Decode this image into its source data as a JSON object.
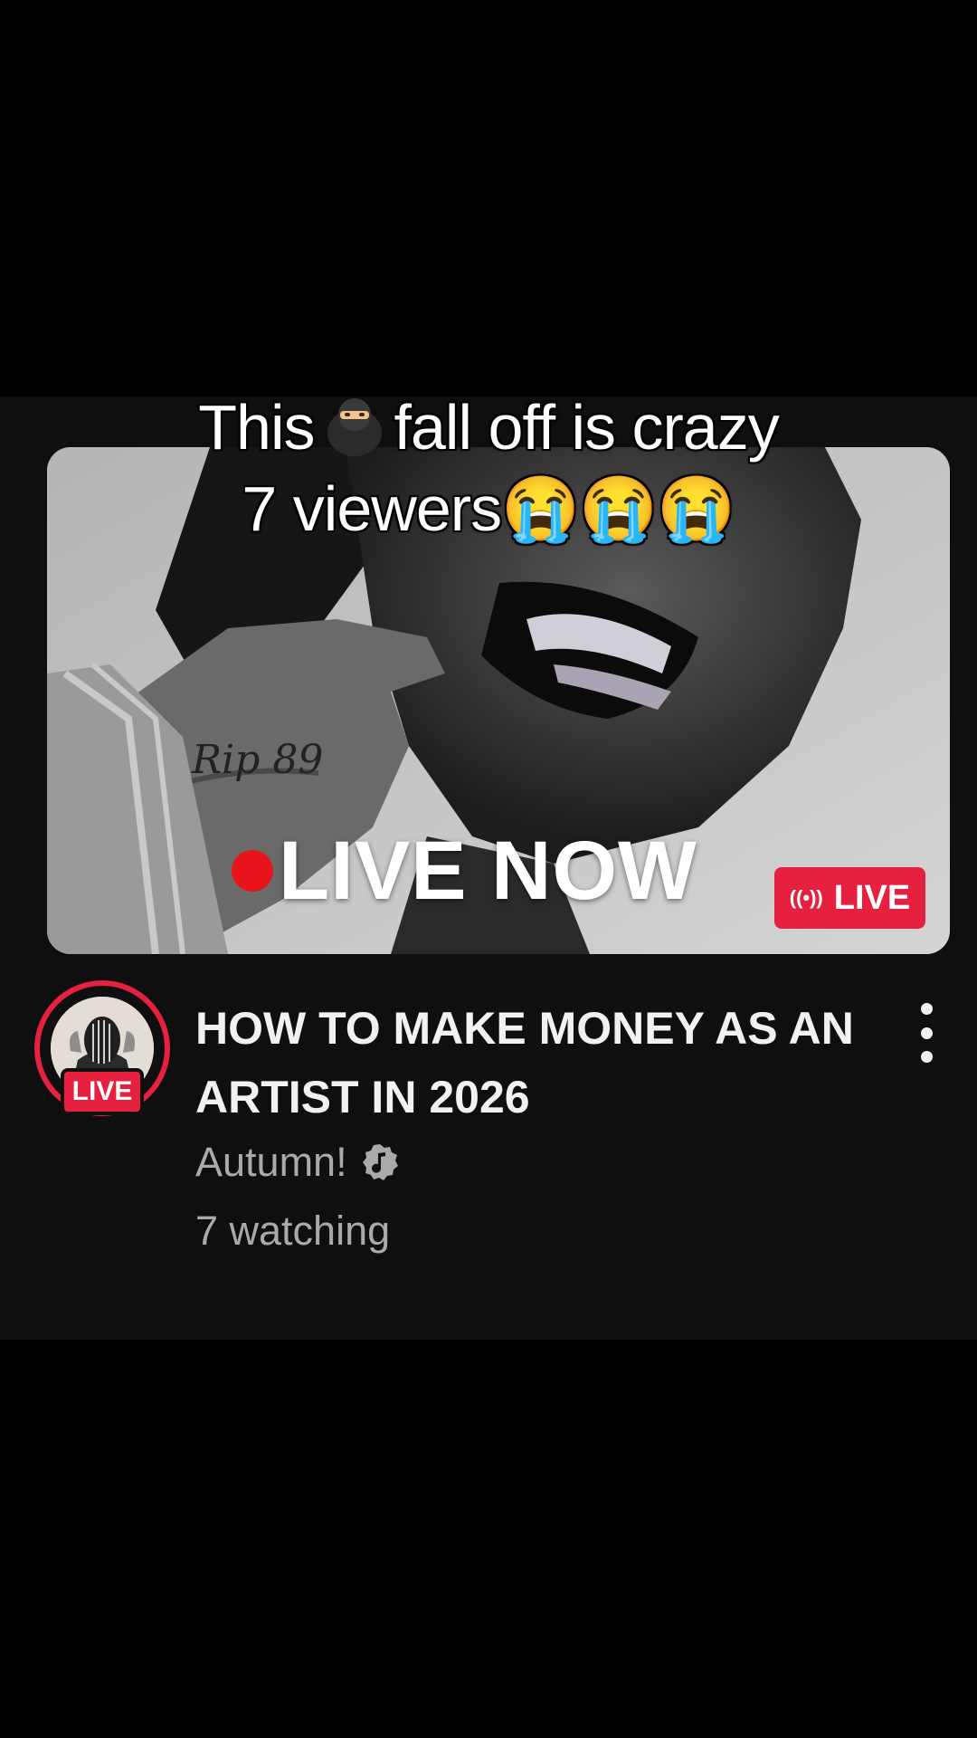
{
  "overlay_caption": {
    "line1_before": "This",
    "line1_emoji": "ninja-emoji",
    "line1_after": "fall off is crazy",
    "line2": "7 viewers😭😭😭"
  },
  "thumbnail": {
    "overlay_text": "LIVE NOW",
    "hand_tattoo": "Rip 89",
    "badge_label": "LIVE",
    "badge_icon": "broadcast-icon"
  },
  "video": {
    "title": "HOW TO MAKE MONEY AS AN ARTIST IN 2026",
    "channel": "Autumn!",
    "channel_badge_icon": "music-note-verified-icon",
    "viewers": "7 watching",
    "avatar_live_label": "LIVE",
    "more_icon": "more-vertical-icon"
  },
  "colors": {
    "background": "#000000",
    "card_background": "#0f0f0f",
    "live_red": "#e5213f",
    "title_text": "#f1f1f1",
    "meta_text": "#aaaaaa"
  }
}
